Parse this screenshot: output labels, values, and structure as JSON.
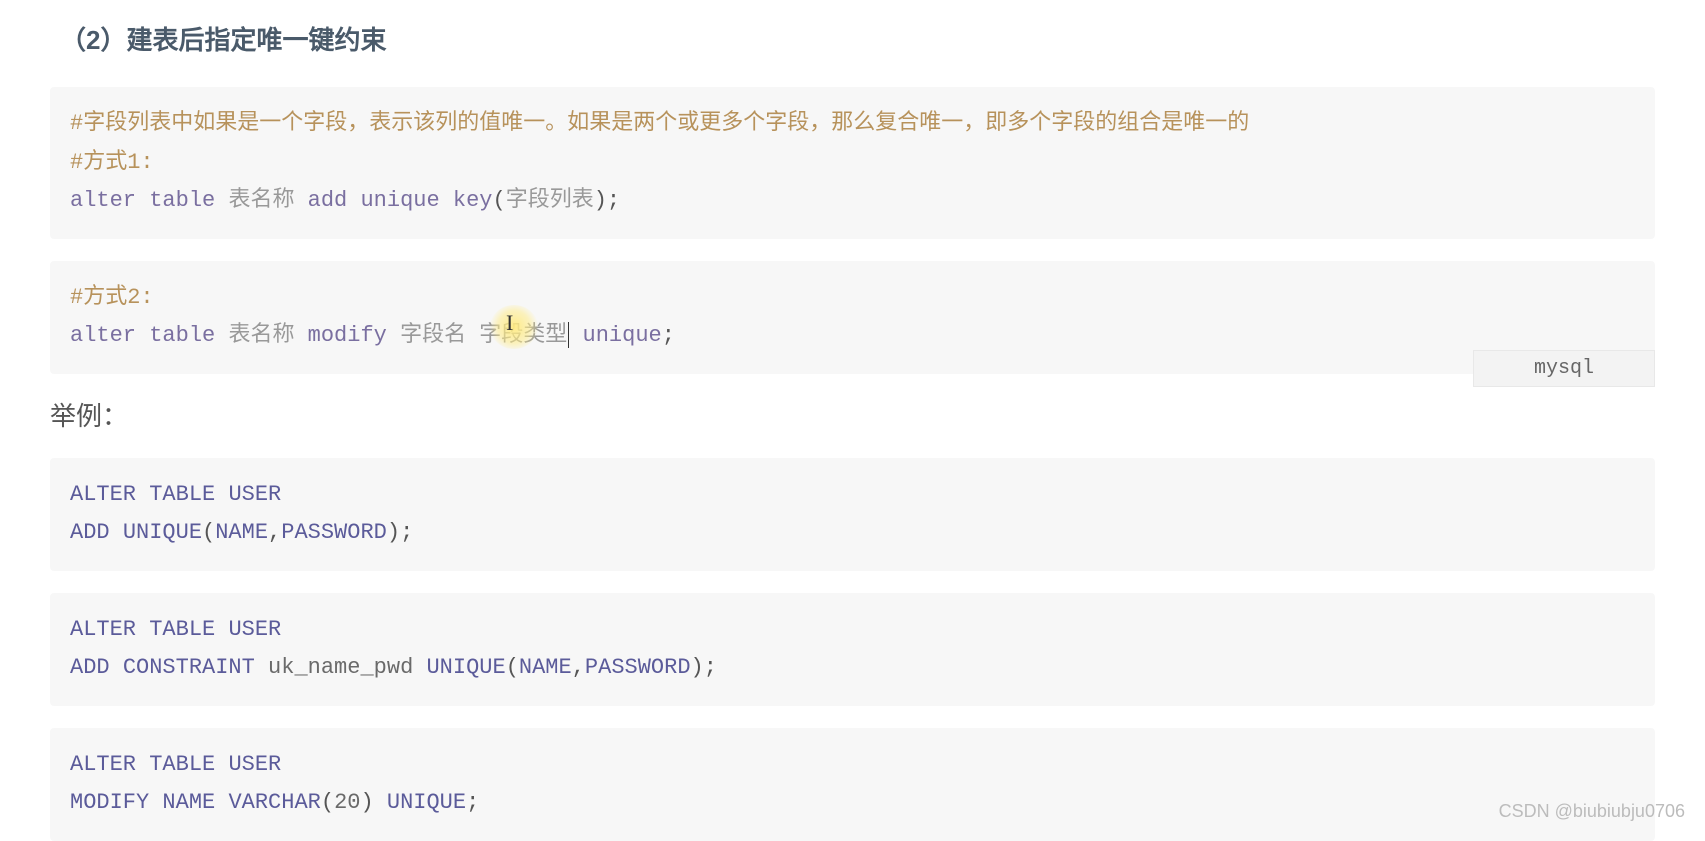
{
  "heading": "（2）建表后指定唯一键约束",
  "block1": {
    "comment1": "#字段列表中如果是一个字段，表示该列的值唯一。如果是两个或更多个字段，那么复合唯一，即多个字段的组合是唯一的",
    "comment2": "#方式1:",
    "kw_alter": "alter",
    "kw_table": "table",
    "tbl": "表名称",
    "kw_add": "add",
    "kw_unique": "unique",
    "kw_key": "key",
    "paren_open": "(",
    "fields": "字段列表",
    "paren_close": ")",
    "semi": ";"
  },
  "block2": {
    "comment1": "#方式2:",
    "kw_alter": "alter",
    "kw_table": "table",
    "tbl": "表名称",
    "kw_modify": "modify",
    "field_name": "字段名",
    "field_type": "字段类型",
    "kw_unique": "unique",
    "semi": ";"
  },
  "sub_heading": "举例：",
  "lang_tag": "mysql",
  "block3": {
    "l1_alter": "ALTER",
    "l1_table": "TABLE",
    "l1_user": "USER",
    "l2_add": "ADD",
    "l2_unique": "UNIQUE",
    "l2_open": "(",
    "l2_name": "NAME",
    "l2_comma": ",",
    "l2_pwd": "PASSWORD",
    "l2_close": ")",
    "l2_semi": ";"
  },
  "block4": {
    "l1_alter": "ALTER",
    "l1_table": "TABLE",
    "l1_user": "USER",
    "l2_add": "ADD",
    "l2_constraint": "CONSTRAINT",
    "l2_ukname": "uk_name_pwd",
    "l2_unique": "UNIQUE",
    "l2_open": "(",
    "l2_name": "NAME",
    "l2_comma": ",",
    "l2_pwd": "PASSWORD",
    "l2_close": ")",
    "l2_semi": ";"
  },
  "block5": {
    "l1_alter": "ALTER",
    "l1_table": "TABLE",
    "l1_user": "USER",
    "l2_modify": "MODIFY",
    "l2_name": "NAME",
    "l2_varchar": "VARCHAR",
    "l2_open": "(",
    "l2_num": "20",
    "l2_close": ")",
    "l2_unique": "UNIQUE",
    "l2_semi": ";"
  },
  "watermark": "CSDN @biubiubju0706",
  "cursor_glyph": "I"
}
